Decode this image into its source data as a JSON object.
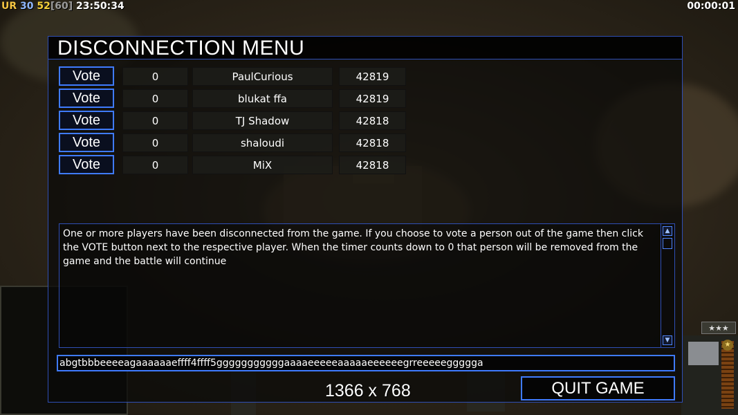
{
  "hud": {
    "ur_label": "UR",
    "val_a": "30",
    "val_b": "52",
    "val_c": "[60]",
    "clock": "23:50:34",
    "timer": "00:00:01"
  },
  "dialog": {
    "title": "DISCONNECTION MENU",
    "vote_label": "Vote",
    "players": [
      {
        "count": "0",
        "name": "PaulCurious",
        "frames": "42819"
      },
      {
        "count": "0",
        "name": "blukat ffa",
        "frames": "42819"
      },
      {
        "count": "0",
        "name": "TJ Shadow",
        "frames": "42818"
      },
      {
        "count": "0",
        "name": "shaloudi",
        "frames": "42818"
      },
      {
        "count": "0",
        "name": "MiX",
        "frames": "42818"
      }
    ],
    "message": "One or more players have been disconnected from the game. If you choose to vote a person out of the game then click the VOTE button next to the respective player. When the timer counts down to 0 that person will be removed from the game and the battle will continue",
    "chat_value": "abgtbbbeeeeagaaaaaaeffff4ffff5gggggggggggaaaaeeeeeaaaaaeeeeeegrreeeeeggggga",
    "resolution": "1366 x 768",
    "quit_label": "QUIT GAME"
  },
  "side": {
    "rank_stars": "★★★",
    "star_icon": "★"
  },
  "colors": {
    "accent": "#3f7bff",
    "border": "#2f4fb6"
  }
}
